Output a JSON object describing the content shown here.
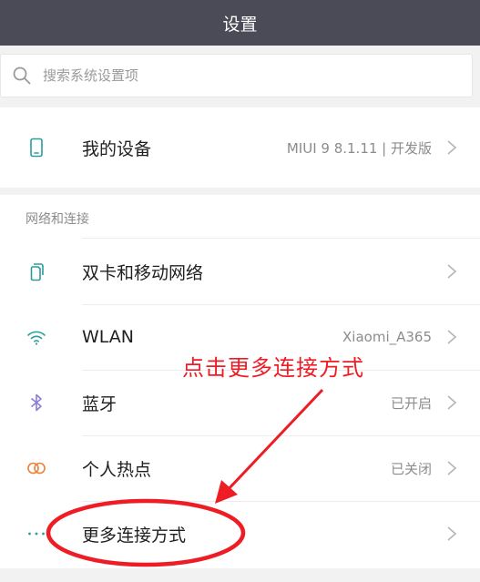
{
  "header": {
    "title": "设置"
  },
  "search": {
    "placeholder": "搜索系统设置项"
  },
  "device": {
    "label": "我的设备",
    "value": "MIUI 9 8.1.11 | 开发版"
  },
  "network": {
    "section_title": "网络和连接",
    "items": [
      {
        "label": "双卡和移动网络",
        "value": "",
        "icon": "sim-cards-icon"
      },
      {
        "label": "WLAN",
        "value": "Xiaomi_A365",
        "icon": "wifi-icon"
      },
      {
        "label": "蓝牙",
        "value": "已开启",
        "icon": "bluetooth-icon"
      },
      {
        "label": "个人热点",
        "value": "已关闭",
        "icon": "hotspot-icon"
      },
      {
        "label": "更多连接方式",
        "value": "",
        "icon": "more-dots-icon"
      }
    ]
  },
  "annotation": {
    "text": "点击更多连接方式",
    "color": "#ee1c24"
  },
  "colors": {
    "titlebar": "#4b4b57",
    "icon_teal": "#2a9c9c",
    "icon_purple": "#8a7fd6",
    "icon_orange": "#e8823a"
  }
}
